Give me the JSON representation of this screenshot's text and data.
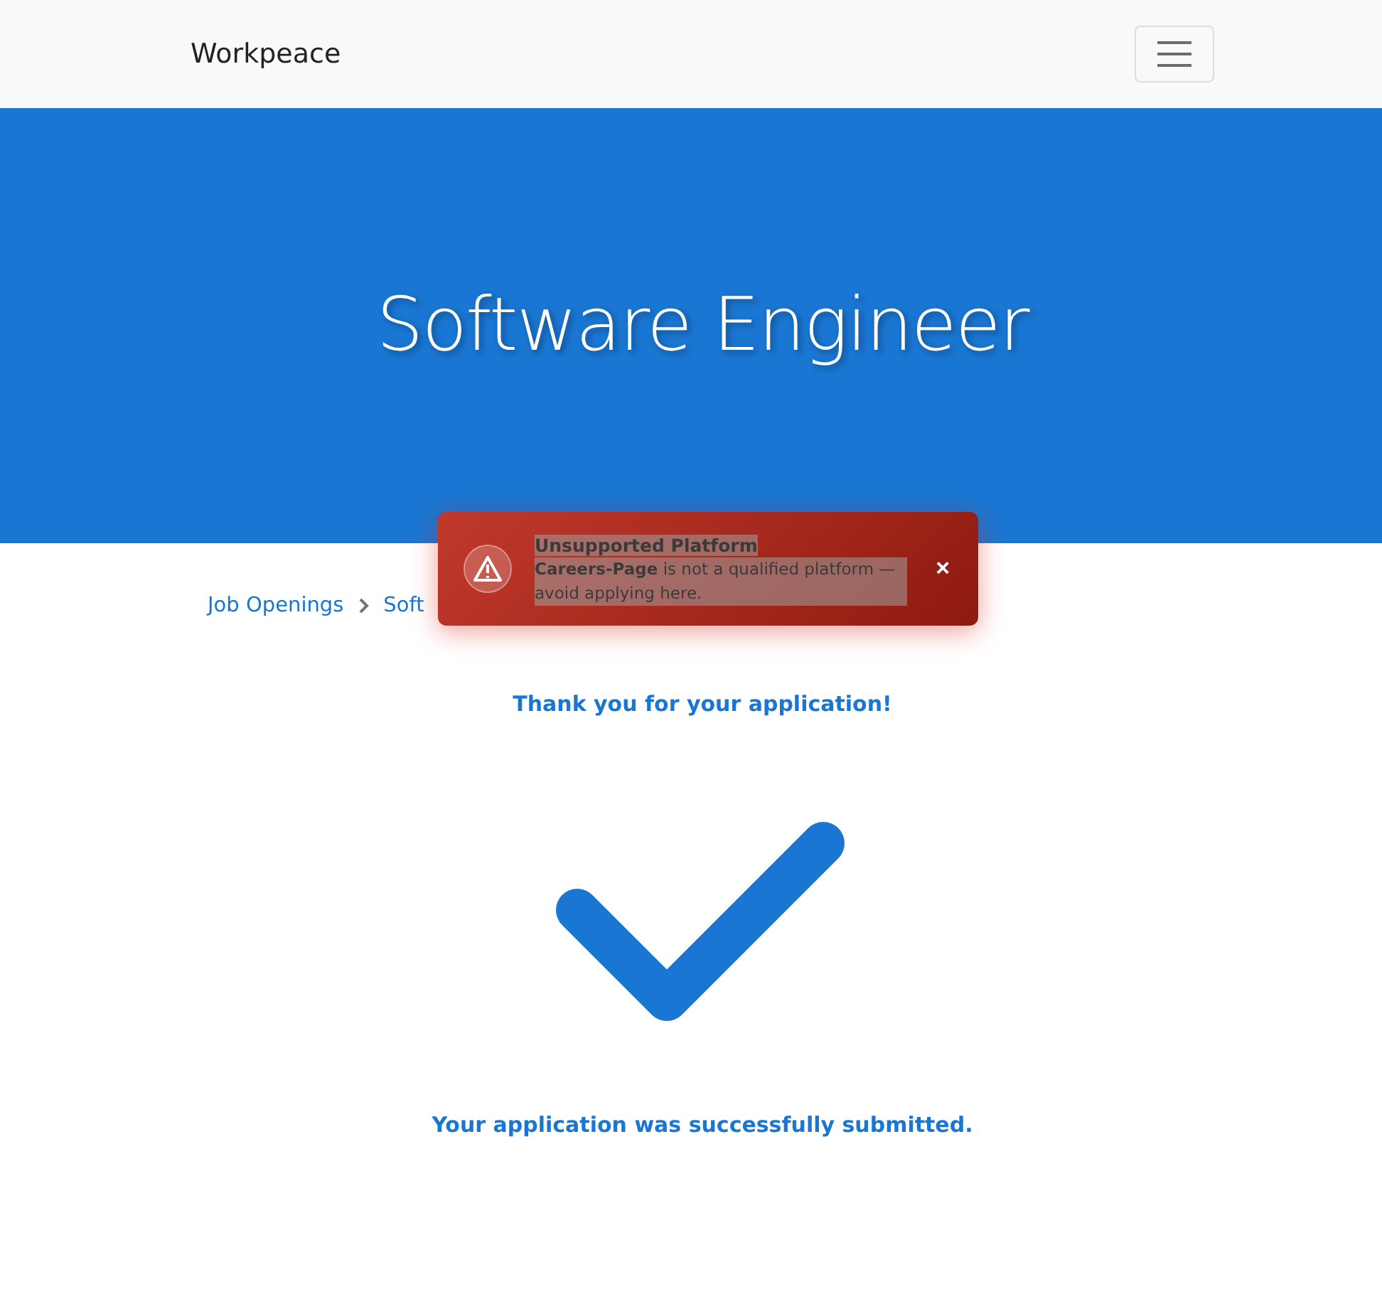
{
  "navbar": {
    "brand": "Workpeace"
  },
  "hero": {
    "title": "Software Engineer"
  },
  "breadcrumb": [
    "Job Openings",
    "Soft"
  ],
  "toast": {
    "title": "Unsupported Platform",
    "message": "**Careers-Page** is not a qualified platform — avoid applying here.",
    "close": "×"
  },
  "confirmation": {
    "heading": "Thank you for your application!",
    "message": "Your application was successfully submitted."
  }
}
